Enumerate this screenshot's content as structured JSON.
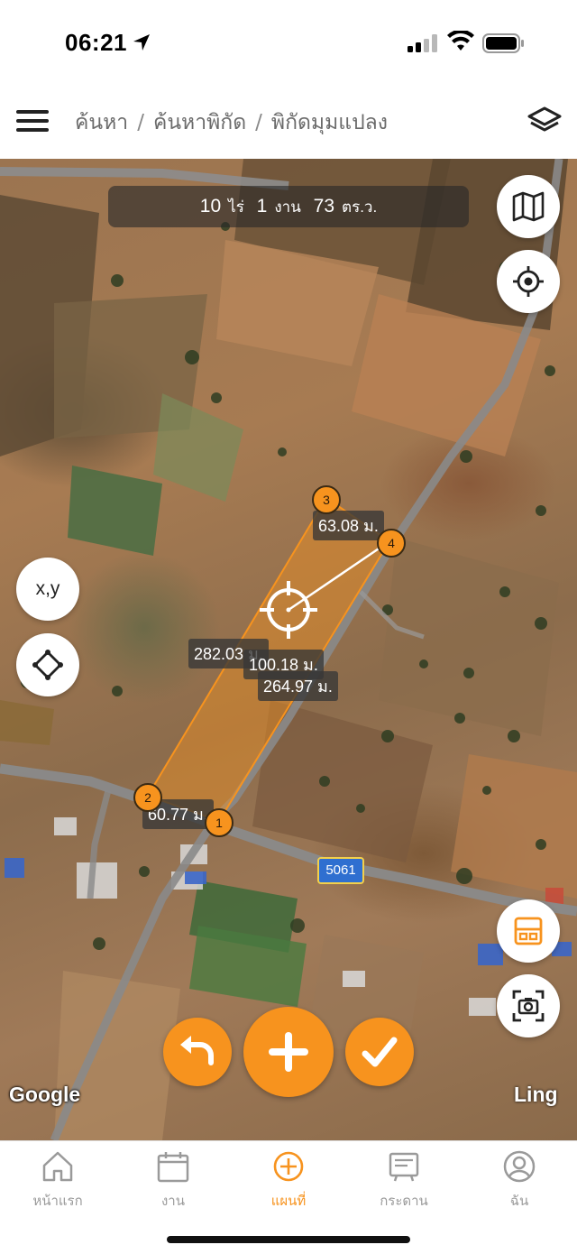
{
  "status_bar": {
    "time": "06:21"
  },
  "header": {
    "breadcrumb": [
      "ค้นหา",
      "ค้นหาพิกัด",
      "พิกัดมุมแปลง"
    ]
  },
  "map": {
    "area": {
      "rai_value": "10",
      "rai_unit": "ไร่",
      "ngan_value": "1",
      "ngan_unit": "งาน",
      "wa_value": "73",
      "wa_unit": "ตร.ว."
    },
    "measurements": {
      "top_edge": "63.08 ม.",
      "left_edge": "282.03 ม.",
      "radius": "100.18 ม.",
      "right_edge": "264.97 ม.",
      "bottom_edge": "60.77 ม."
    },
    "vertices": [
      "1",
      "2",
      "3",
      "4"
    ],
    "road_number": "5061",
    "attribution_left": "Google",
    "attribution_right": "Ling",
    "xy_label": "x,y"
  },
  "tabs": [
    {
      "label": "หน้าแรก",
      "icon": "home-icon",
      "active": false
    },
    {
      "label": "งาน",
      "icon": "calendar-icon",
      "active": false
    },
    {
      "label": "แผนที่",
      "icon": "add-circle-icon",
      "active": true
    },
    {
      "label": "กระดาน",
      "icon": "board-icon",
      "active": false
    },
    {
      "label": "ฉัน",
      "icon": "user-icon",
      "active": false
    }
  ],
  "colors": {
    "accent": "#f7931e",
    "tab_inactive": "#9a9a9a"
  }
}
